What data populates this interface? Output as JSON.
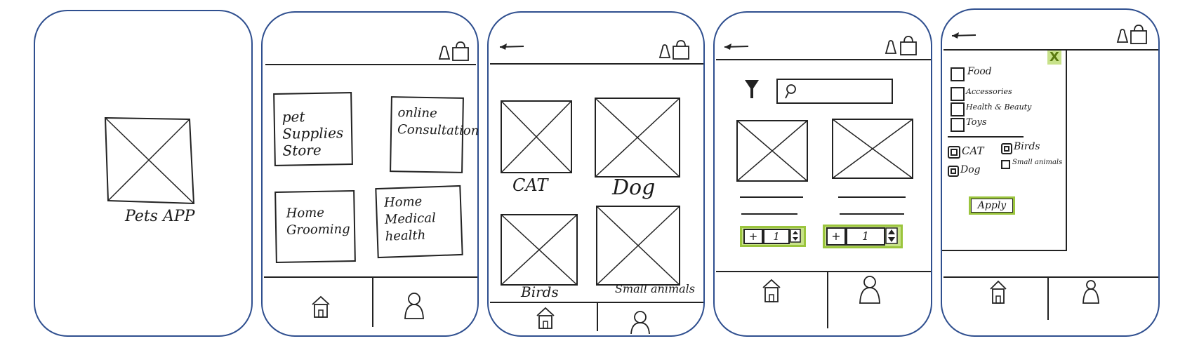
{
  "screen1": {
    "app_title": "Pets APP"
  },
  "screen2": {
    "tiles": [
      {
        "label": "pet Supplies Store"
      },
      {
        "label": "online Consultation"
      },
      {
        "label": "Home Grooming"
      },
      {
        "label": "Home Medical health"
      }
    ]
  },
  "screen3": {
    "categories": [
      {
        "label": "CAT"
      },
      {
        "label": "Dog"
      },
      {
        "label": "Birds"
      },
      {
        "label": "Small animals"
      }
    ]
  },
  "screen4": {
    "products": [
      {
        "qty": "1",
        "plus": "+"
      },
      {
        "qty": "1",
        "plus": "+"
      }
    ]
  },
  "screen5": {
    "close": "X",
    "product_filters": [
      "Food",
      "Accessories",
      "Health & Beauty",
      "Toys"
    ],
    "pet_filters": [
      "CAT",
      "Birds",
      "Dog",
      "Small animals"
    ],
    "apply_label": "Apply"
  },
  "colors": {
    "frame": "#2f4f8f",
    "highlight": "#9bc53d",
    "highlight_fill": "#c8e28a"
  }
}
